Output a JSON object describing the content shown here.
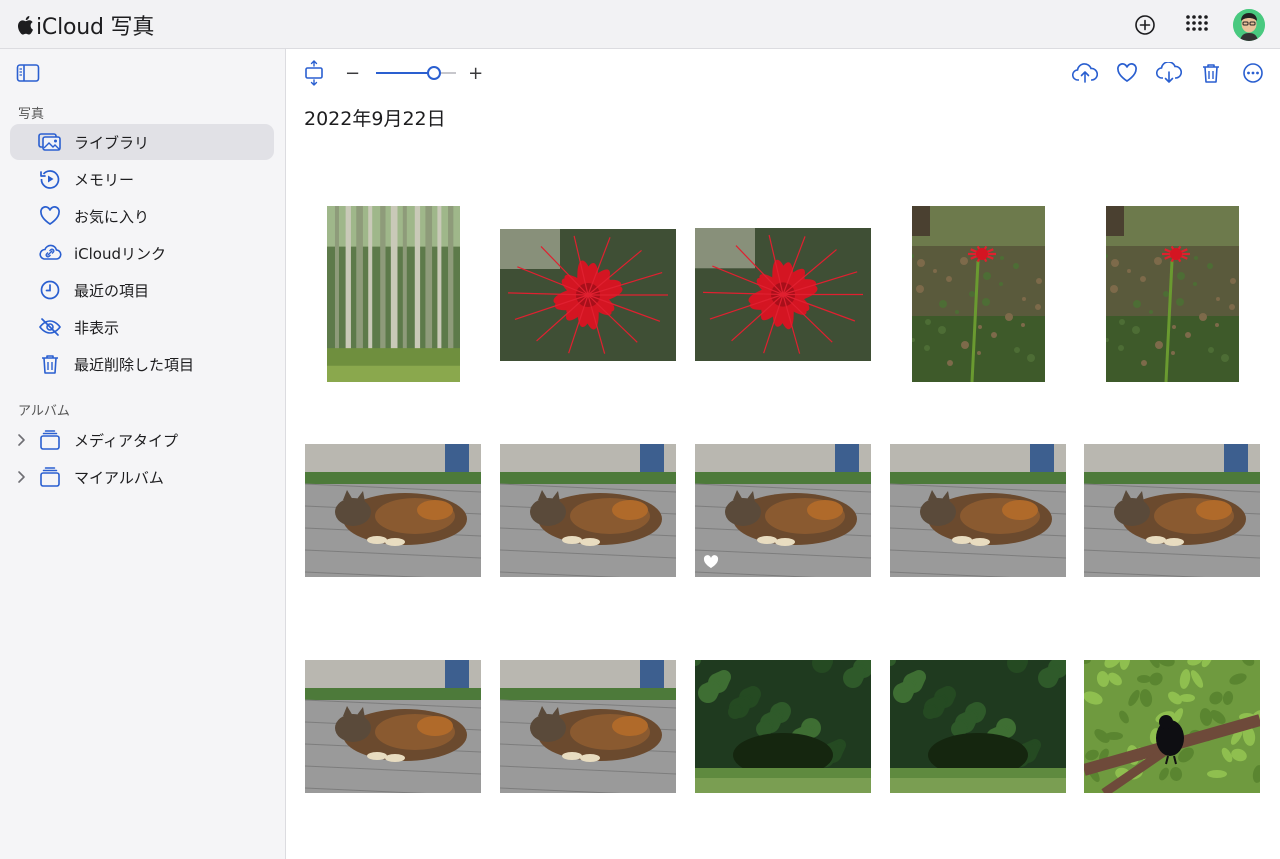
{
  "app": {
    "title": "iCloud 写真"
  },
  "topbar": {
    "icons": [
      "apple-logo-icon",
      "add-icon",
      "app-grid-icon",
      "avatar"
    ]
  },
  "sidebar": {
    "photos_section": "写真",
    "items": [
      {
        "label": "ライブラリ",
        "icon": "library-icon",
        "selected": true
      },
      {
        "label": "メモリー",
        "icon": "memories-icon"
      },
      {
        "label": "お気に入り",
        "icon": "heart-icon"
      },
      {
        "label": "iCloudリンク",
        "icon": "link-icon"
      },
      {
        "label": "最近の項目",
        "icon": "clock-icon"
      },
      {
        "label": "非表示",
        "icon": "eye-slash-icon"
      },
      {
        "label": "最近削除した項目",
        "icon": "trash-icon"
      }
    ],
    "albums_section": "アルバム",
    "albums": [
      {
        "label": "メディアタイプ",
        "icon": "album-stack-icon"
      },
      {
        "label": "マイアルバム",
        "icon": "album-stack-icon"
      }
    ]
  },
  "toolbar": {
    "zoom_minus": "−",
    "zoom_plus": "+",
    "zoom_level": 0.72,
    "right_icons": [
      "upload-icon",
      "heart-icon",
      "download-icon",
      "trash-icon",
      "more-icon"
    ]
  },
  "main": {
    "date_heading": "2022年9月22日"
  },
  "colors": {
    "accent": "#2a5fd0",
    "sidebar_bg": "#f5f5f7",
    "selected_bg": "#e1e1e6"
  },
  "photos": [
    {
      "subject": "bamboo"
    },
    {
      "subject": "red-spider-lily-closeup"
    },
    {
      "subject": "red-spider-lily-closeup"
    },
    {
      "subject": "red-spider-lily-in-forest"
    },
    {
      "subject": "red-spider-lily-in-forest"
    },
    {
      "subject": "sleeping-cat"
    },
    {
      "subject": "sleeping-cat"
    },
    {
      "subject": "sleeping-cat",
      "favorite": true
    },
    {
      "subject": "sleeping-cat"
    },
    {
      "subject": "sleeping-cat"
    },
    {
      "subject": "sleeping-cat"
    },
    {
      "subject": "sleeping-cat"
    },
    {
      "subject": "bushes"
    },
    {
      "subject": "bushes"
    },
    {
      "subject": "crow-in-tree"
    }
  ]
}
